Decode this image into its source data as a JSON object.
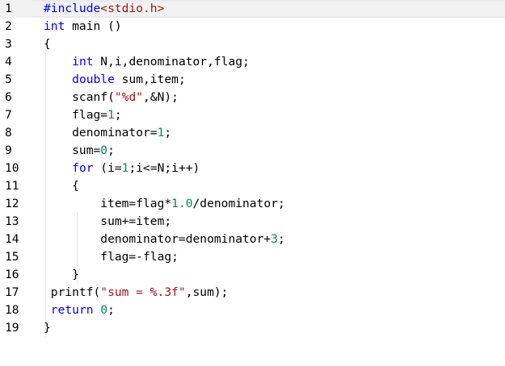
{
  "editor": {
    "lines": [
      {
        "n": "1",
        "tokens": [
          [
            "pp",
            "#include"
          ],
          [
            "str",
            "<stdio.h>"
          ]
        ]
      },
      {
        "n": "2",
        "tokens": [
          [
            "kw",
            "int"
          ],
          [
            "txt",
            " main ()"
          ]
        ]
      },
      {
        "n": "3",
        "tokens": [
          [
            "txt",
            "{"
          ]
        ]
      },
      {
        "n": "4",
        "tokens": [
          [
            "txt",
            "    "
          ],
          [
            "kw",
            "int"
          ],
          [
            "txt",
            " N,i,denominator,flag;"
          ]
        ]
      },
      {
        "n": "5",
        "tokens": [
          [
            "txt",
            "    "
          ],
          [
            "kw",
            "double"
          ],
          [
            "txt",
            " sum,item;"
          ]
        ]
      },
      {
        "n": "6",
        "tokens": [
          [
            "txt",
            "    scanf("
          ],
          [
            "str",
            "\"%d\""
          ],
          [
            "txt",
            ",&N);"
          ]
        ]
      },
      {
        "n": "7",
        "tokens": [
          [
            "txt",
            "    flag="
          ],
          [
            "num",
            "1"
          ],
          [
            "txt",
            ";"
          ]
        ]
      },
      {
        "n": "8",
        "tokens": [
          [
            "txt",
            "    denominator="
          ],
          [
            "num",
            "1"
          ],
          [
            "txt",
            ";"
          ]
        ]
      },
      {
        "n": "9",
        "tokens": [
          [
            "txt",
            "    sum="
          ],
          [
            "num",
            "0"
          ],
          [
            "txt",
            ";"
          ]
        ]
      },
      {
        "n": "10",
        "tokens": [
          [
            "txt",
            "    "
          ],
          [
            "kw",
            "for"
          ],
          [
            "txt",
            " (i="
          ],
          [
            "num",
            "1"
          ],
          [
            "txt",
            ";i<=N;i++)"
          ]
        ]
      },
      {
        "n": "11",
        "tokens": [
          [
            "txt",
            "    {"
          ]
        ]
      },
      {
        "n": "12",
        "tokens": [
          [
            "txt",
            "        item=flag*"
          ],
          [
            "num",
            "1.0"
          ],
          [
            "txt",
            "/denominator;"
          ]
        ]
      },
      {
        "n": "13",
        "tokens": [
          [
            "txt",
            "        sum+=item;"
          ]
        ]
      },
      {
        "n": "14",
        "tokens": [
          [
            "txt",
            "        denominator=denominator+"
          ],
          [
            "num",
            "3"
          ],
          [
            "txt",
            ";"
          ]
        ]
      },
      {
        "n": "15",
        "tokens": [
          [
            "txt",
            "        flag=-flag;"
          ]
        ]
      },
      {
        "n": "16",
        "tokens": [
          [
            "txt",
            "    }"
          ]
        ]
      },
      {
        "n": "17",
        "tokens": [
          [
            "txt",
            " printf("
          ],
          [
            "str",
            "\"sum = %.3f\""
          ],
          [
            "txt",
            ",sum);"
          ]
        ]
      },
      {
        "n": "18",
        "tokens": [
          [
            "txt",
            " "
          ],
          [
            "kw",
            "return"
          ],
          [
            "txt",
            " "
          ],
          [
            "num",
            "0"
          ],
          [
            "txt",
            ";"
          ]
        ]
      },
      {
        "n": "19",
        "tokens": [
          [
            "txt",
            "}"
          ]
        ]
      }
    ],
    "active_line": 1,
    "colors": {
      "keyword": "#0000ff",
      "string": "#a31515",
      "number": "#098658",
      "text": "#000000",
      "line_number": "#000000"
    }
  }
}
